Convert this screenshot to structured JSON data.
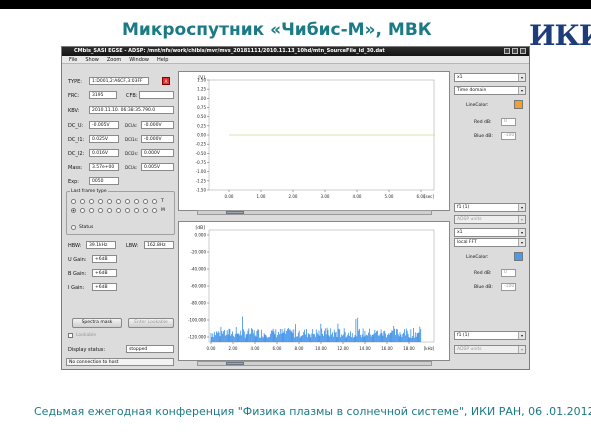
{
  "slide": {
    "title": "Микроспутник «Чибис-М», МВК",
    "logo_text": "ИКИ",
    "footer": "Седьмая ежегодная конференция \"Физика плазмы в солнечной системе\", ИКИ РАН, 06 .01.2012"
  },
  "window": {
    "title": "CMbis_SASI EGSE - ADSP: /mnt/nfs/work/chibis/mvr/mvs_20181111/2010.11.13_10hd/mtn_SourceFile_id_30.dat",
    "menu": [
      "File",
      "Show",
      "Zoom",
      "Window",
      "Help"
    ]
  },
  "left_panel": {
    "fields": [
      {
        "label": "TYPE:",
        "value": "1:D001,2:A6CF,3:03FF"
      },
      {
        "label": "FRC:",
        "value": "3195"
      },
      {
        "label": "KBV:",
        "value": "2010.11.10. 06:38:35.790.0"
      }
    ],
    "cfb_label": "CFB:",
    "cfb_value": "",
    "red_button": "A",
    "voltage_rows": [
      {
        "label": "DC_U:",
        "value": "-0.005V",
        "sub_label": "DCUs:",
        "sub_value": "-0.000V"
      },
      {
        "label": "DC_I1:",
        "value": "0.025V",
        "sub_label": "DCI1s:",
        "sub_value": "-0.000V"
      },
      {
        "label": "DC_I2:",
        "value": "0.016V",
        "sub_label": "DCI2s:",
        "sub_value": "0.000V"
      },
      {
        "label": "Mass:",
        "value": "3.57e+00",
        "sub_label": "DCUs:",
        "sub_value": "0.005V"
      }
    ],
    "exp_label": "Exp:",
    "exp_value": "0050",
    "frame_group_label": "Last frame type",
    "frame_right_labels": [
      "T",
      "M"
    ],
    "status_label": "Status",
    "hbw_label": "HBW:",
    "hbw_value": "39.1kHz",
    "lbw_label": "LBW:",
    "lbw_value": "162.8Hz",
    "gains": [
      {
        "label": "U Gain:",
        "value": "+6dB"
      },
      {
        "label": "B Gain:",
        "value": "+6dB"
      },
      {
        "label": "I Gain:",
        "value": "+6dB"
      }
    ],
    "spectra_mask_button": "Spectra mask",
    "disabled_button": "Enter Lookable",
    "checkbox_label": "Lookable",
    "display_status_label": "Display status:",
    "display_status_value": "stopped",
    "connection_status": "No connection to host"
  },
  "top_plot": {
    "y_unit": "[V]",
    "y_ticks": [
      "1.50",
      "1.25",
      "1.00",
      "0.75",
      "0.50",
      "0.25",
      "0.00",
      "-0.25",
      "-0.50",
      "-0.75",
      "-1.00",
      "-1.25",
      "-1.50"
    ],
    "x_ticks": [
      "0.00",
      "1.00",
      "2.00",
      "3.00",
      "4.00",
      "5.00",
      "6.00"
    ],
    "x_unit": "[sec]",
    "line_color": "#d8d890"
  },
  "bottom_plot": {
    "y_unit": "[dB]",
    "y_ticks": [
      "0.000",
      "-20.000",
      "-40.000",
      "-60.000",
      "-80.000",
      "-100.000",
      "-120.000"
    ],
    "x_ticks": [
      "0.00",
      "2.00",
      "4.00",
      "6.00",
      "8.00",
      "10.00",
      "12.00",
      "14.00",
      "16.00",
      "18.00"
    ],
    "x_unit": "[kHz]",
    "bar_color": "#3a8ee6"
  },
  "right_top": {
    "channel": "x1",
    "mode": "Time domain",
    "line_color_label": "LineColor:",
    "line_color": "#f0a030",
    "red_label": "Red dB:",
    "red_value": "0",
    "blue_label": "Blue dB:",
    "blue_value": "-100",
    "filter": "f1 (1)",
    "disabled_combo": "ADSP units"
  },
  "right_bottom": {
    "channel": "x1",
    "mode": "local FFT",
    "line_color_label": "LineColor:",
    "line_color": "#4a9be8",
    "red_label": "Red dB:",
    "red_value": "0",
    "blue_label": "Blue dB:",
    "blue_value": "-100",
    "filter": "f1 (1)",
    "disabled_combo": "ADSP units"
  }
}
